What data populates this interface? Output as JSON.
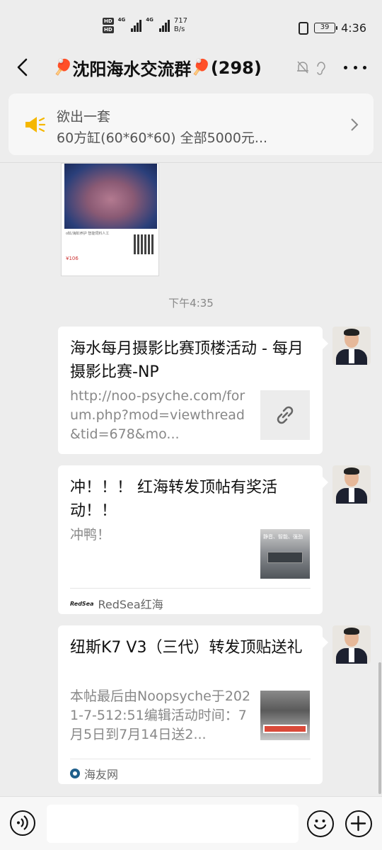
{
  "status_bar": {
    "net1": "4G",
    "net2": "4G",
    "speed_value": "717",
    "speed_unit": "B/s",
    "battery": "39",
    "time": "4:36",
    "hd1": "HD",
    "hd2": "HD"
  },
  "chat": {
    "title": "沈阳海水交流群",
    "member_count": "(298)",
    "title_emoji": "🏓"
  },
  "announcement": {
    "line1": "欲出一套",
    "line2": "60方缸(60*60*60)  全部5000元..."
  },
  "image_message": {
    "caption": "o缸/海缸养护 智能饲料人工",
    "price": "¥106"
  },
  "timestamp": "下午4:35",
  "messages": [
    {
      "title": "海水每月摄影比赛顶楼活动 - 每月摄影比赛-NP",
      "desc": "http://noo-psyche.com/forum.php?mod=viewthread&tid=678&mo...",
      "thumb": "link-icon",
      "source": ""
    },
    {
      "title": "冲！！！ 红海转发顶帖有奖活动！！",
      "desc": "冲鸭！",
      "thumb_text": "静音、智能、强劲",
      "source": "RedSea红海",
      "source_logo": "RedSea"
    },
    {
      "title": "纽斯K7 V3（三代）转发顶贴送礼",
      "desc": "本帖最后由Noopsyche于2021-7-512:51编辑活动时间：7月5日到7月14日送2...",
      "source": "海友网"
    }
  ],
  "icons": {
    "back": "back-arrow-icon",
    "mute": "mute-bell-icon",
    "ear": "earpiece-icon",
    "more": "more-icon",
    "speaker": "announcement-speaker-icon",
    "voice": "voice-input-icon",
    "emoji": "emoji-icon",
    "plus": "plus-icon"
  },
  "colors": {
    "background": "#ededed",
    "card": "#ffffff",
    "speaker": "#f5b700",
    "muted_text": "#888888"
  }
}
